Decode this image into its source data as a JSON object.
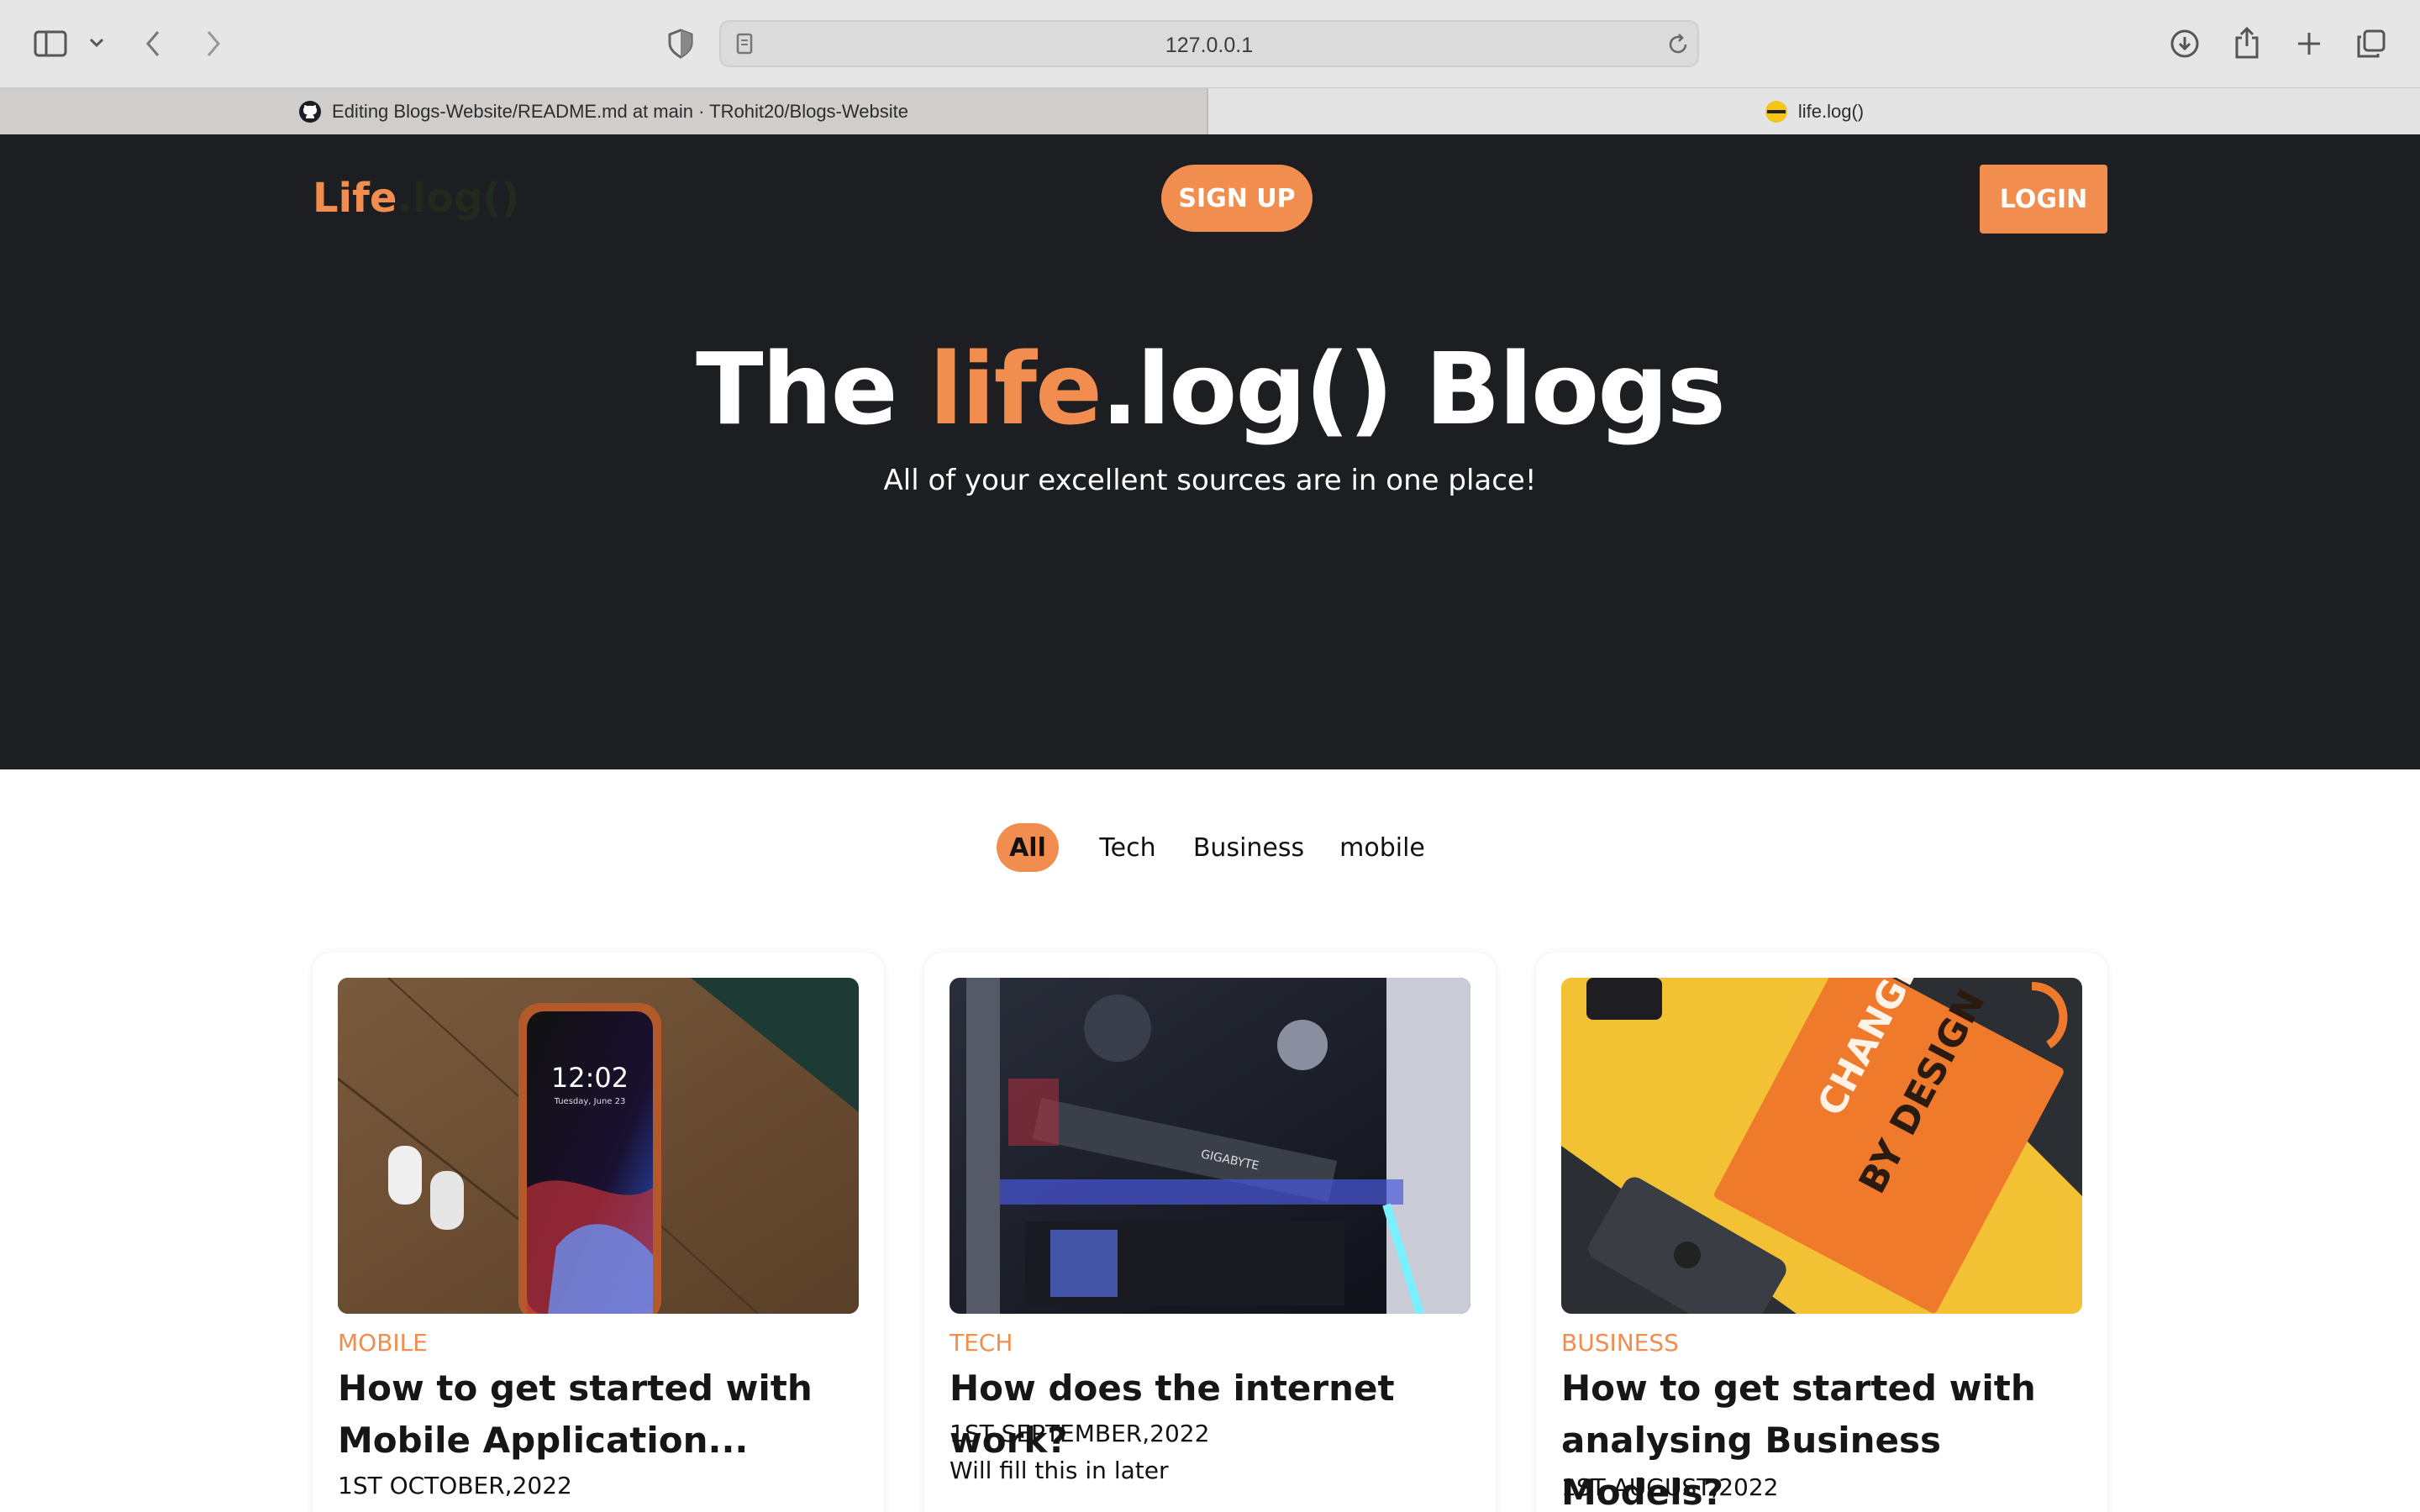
{
  "browser": {
    "url": "127.0.0.1",
    "tabs": [
      {
        "title": "Editing Blogs-Website/README.md at main · TRohit20/Blogs-Website",
        "active": false,
        "icon": "github-icon"
      },
      {
        "title": "life.log()",
        "active": true,
        "icon": "site-favicon"
      }
    ]
  },
  "header": {
    "logo_part1": "Life",
    "logo_part2": ".log()",
    "signup_label": "SIGN UP",
    "login_label": "LOGIN"
  },
  "hero": {
    "title_before": "The ",
    "title_accent": "life",
    "title_after": ".log() Blogs",
    "subtitle": "All of your excellent sources are in one place!"
  },
  "filters": [
    {
      "label": "All",
      "active": true
    },
    {
      "label": "Tech",
      "active": false
    },
    {
      "label": "Business",
      "active": false
    },
    {
      "label": "mobile",
      "active": false
    }
  ],
  "cards": [
    {
      "category": "MOBILE",
      "title": "How to get started with Mobile Application...",
      "date": "1ST OCTOBER,2022",
      "description": "",
      "image": "phone-photo"
    },
    {
      "category": "TECH",
      "title": "How does the internet work?",
      "date": "1ST SEPTEMBER,2022",
      "description": "Will fill this in later",
      "image": "pc-hardware-photo"
    },
    {
      "category": "BUSINESS",
      "title": "How to get started with analysing Business Models?",
      "date": "1ST AUGUST,2022",
      "description": "",
      "image": "book-photo"
    }
  ],
  "colors": {
    "accent": "#f08d4f",
    "hero_bg": "#1c1e21"
  }
}
